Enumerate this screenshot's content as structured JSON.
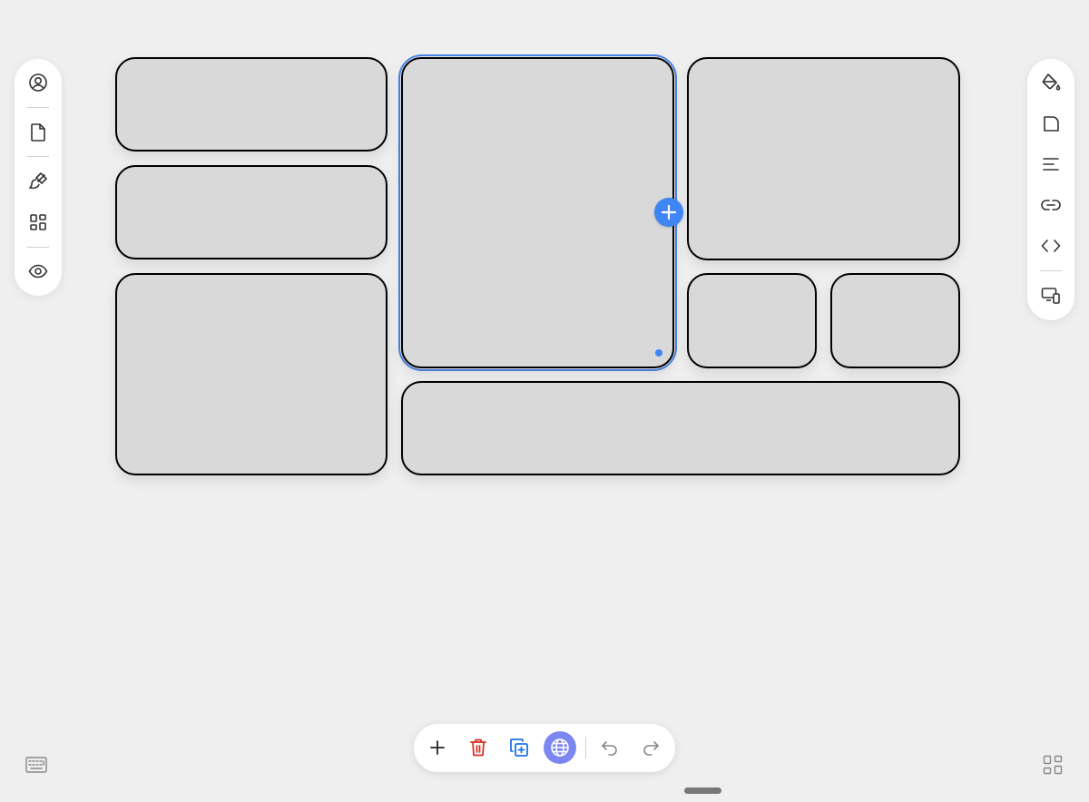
{
  "canvas": {
    "tiles": [
      {
        "id": "tile-left-1"
      },
      {
        "id": "tile-left-2"
      },
      {
        "id": "tile-left-3"
      },
      {
        "id": "tile-center-selected",
        "selected": true
      },
      {
        "id": "tile-right-top"
      },
      {
        "id": "tile-right-small-1"
      },
      {
        "id": "tile-right-small-2"
      },
      {
        "id": "tile-bottom-wide"
      }
    ],
    "accent_color": "#3f85f4"
  },
  "left_toolbar": {
    "items": [
      {
        "icon": "profile-icon"
      },
      {
        "icon": "page-icon"
      },
      {
        "icon": "brush-icon"
      },
      {
        "icon": "widgets-icon"
      },
      {
        "icon": "preview-eye-icon"
      }
    ]
  },
  "right_toolbar": {
    "items": [
      {
        "icon": "paint-bucket-icon"
      },
      {
        "icon": "corner-radius-icon"
      },
      {
        "icon": "text-align-icon"
      },
      {
        "icon": "link-icon"
      },
      {
        "icon": "code-icon"
      },
      {
        "icon": "device-preview-icon"
      }
    ]
  },
  "bottom_toolbar": {
    "items": [
      {
        "icon": "add-icon"
      },
      {
        "icon": "delete-icon",
        "color": "#d93025"
      },
      {
        "icon": "duplicate-icon",
        "color": "#1a73e8"
      },
      {
        "icon": "globe-icon",
        "active": true,
        "color": "#7b86f0"
      },
      {
        "icon": "undo-icon"
      },
      {
        "icon": "redo-icon"
      }
    ]
  },
  "corners": {
    "bottom_left": "keyboard-icon",
    "bottom_right": "grid-icon"
  }
}
